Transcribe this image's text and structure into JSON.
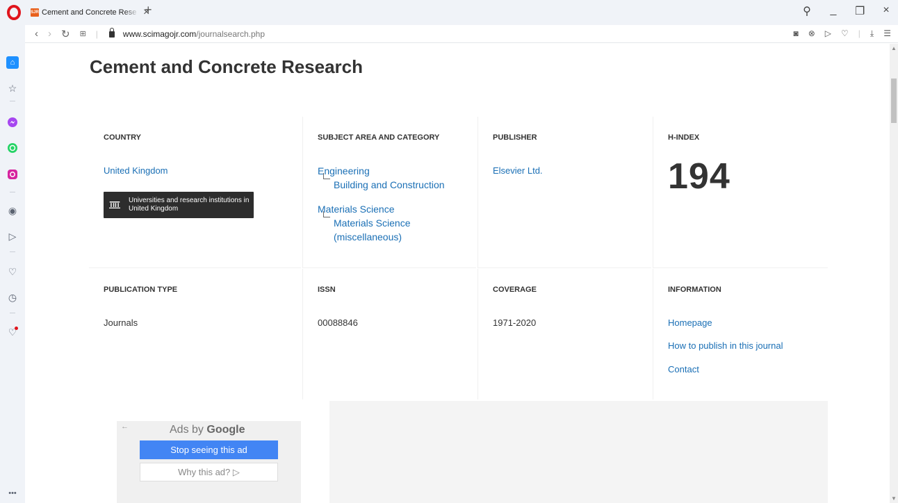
{
  "browser": {
    "tab_title": "Cement and Concrete Rese",
    "favicon_text": "SJR",
    "url_host": "www.scimagojr.com",
    "url_path": "/journalsearch.php"
  },
  "page": {
    "title": "Cement and Concrete Research"
  },
  "country": {
    "heading": "COUNTRY",
    "link": "United Kingdom",
    "institutions_button": "Universities and research institutions in United Kingdom"
  },
  "subject": {
    "heading": "SUBJECT AREA AND CATEGORY",
    "areas": [
      {
        "area": "Engineering",
        "category": "Building and Construction"
      },
      {
        "area": "Materials Science",
        "category": "Materials Science (miscellaneous)"
      }
    ]
  },
  "publisher": {
    "heading": "PUBLISHER",
    "link": "Elsevier Ltd."
  },
  "hindex": {
    "heading": "H-INDEX",
    "value": "194"
  },
  "publication_type": {
    "heading": "PUBLICATION TYPE",
    "value": "Journals"
  },
  "issn": {
    "heading": "ISSN",
    "value": "00088846"
  },
  "coverage": {
    "heading": "COVERAGE",
    "value": "1971-2020"
  },
  "information": {
    "heading": "INFORMATION",
    "links": [
      "Homepage",
      "How to publish in this journal",
      "Contact"
    ]
  },
  "ad": {
    "ads_by": "Ads by",
    "google": "Google",
    "stop_label": "Stop seeing this ad",
    "why_label": "Why this ad? ▷"
  },
  "colors": {
    "link": "#1a6fb5",
    "heading_text": "#333333",
    "chrome_bg": "#f0f3f8",
    "ad_button": "#4285f4"
  }
}
